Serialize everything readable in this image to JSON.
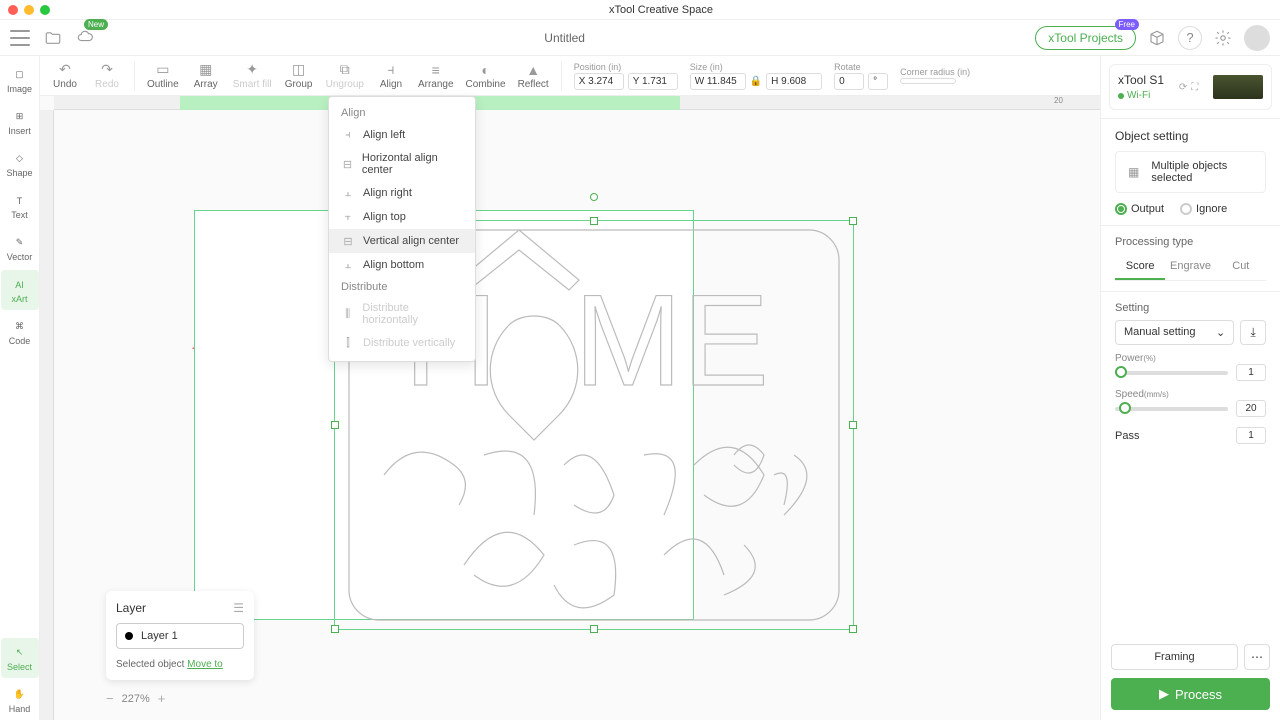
{
  "titlebar": {
    "app": "xTool Creative Space"
  },
  "filebar": {
    "doc": "Untitled",
    "projects": "xTool Projects"
  },
  "rail": {
    "items": [
      "Image",
      "Insert",
      "Shape",
      "Text",
      "Vector",
      "xArt",
      "Code"
    ],
    "bottom": [
      "Select",
      "Hand"
    ]
  },
  "toolbar": {
    "undo": "Undo",
    "redo": "Redo",
    "outline": "Outline",
    "array": "Array",
    "smartfill": "Smart fill",
    "group": "Group",
    "ungroup": "Ungroup",
    "align": "Align",
    "arrange": "Arrange",
    "combine": "Combine",
    "reflect": "Reflect",
    "pos_label": "Position (in)",
    "x": "X 3.274",
    "y": "Y 1.731",
    "size_label": "Size (in)",
    "w": "W 11.845",
    "h": "H 9.608",
    "rotate_label": "Rotate",
    "rotate": "0",
    "deg": "°",
    "corner_label": "Corner radius (in)"
  },
  "align_menu": {
    "header1": "Align",
    "items": [
      "Align left",
      "Horizontal align center",
      "Align right",
      "Align top",
      "Vertical align center",
      "Align bottom"
    ],
    "header2": "Distribute",
    "dist": [
      "Distribute horizontally",
      "Distribute vertically"
    ]
  },
  "layer": {
    "title": "Layer",
    "name": "Layer 1",
    "selected": "Selected object",
    "move": "Move to"
  },
  "zoom": "227%",
  "device": {
    "name": "xTool S1",
    "conn": "Wi-Fi"
  },
  "objsetting": {
    "title": "Object setting",
    "multi": "Multiple objects selected",
    "output": "Output",
    "ignore": "Ignore",
    "proc_label": "Processing type",
    "tabs": [
      "Score",
      "Engrave",
      "Cut"
    ],
    "setting_label": "Setting",
    "mode": "Manual setting",
    "power_label": "Power",
    "power_unit": "(%)",
    "power": "1",
    "speed_label": "Speed",
    "speed_unit": "(mm/s)",
    "speed": "20",
    "pass_label": "Pass",
    "pass": "1"
  },
  "buttons": {
    "framing": "Framing",
    "process": "Process"
  }
}
